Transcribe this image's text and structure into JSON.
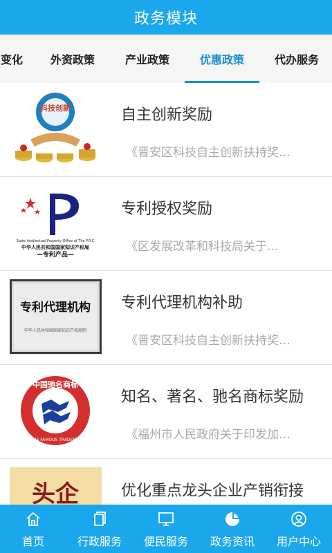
{
  "header": {
    "title": "政务模块"
  },
  "tabs": [
    {
      "label": "变化",
      "active": false
    },
    {
      "label": "外资政策",
      "active": false
    },
    {
      "label": "产业政策",
      "active": false
    },
    {
      "label": "优惠政策",
      "active": true
    },
    {
      "label": "代办服务",
      "active": false
    }
  ],
  "items": [
    {
      "title": "自主创新奖励",
      "summary": "《晋安区科技自主创新扶持奖…",
      "thumb_text": "科技创新"
    },
    {
      "title": "专利授权奖励",
      "summary": "《区发展改革和科技局关于…",
      "thumb_text_1": "State Intellectual Property Office of The P.R.C",
      "thumb_text_2": "中华人民共和国国家知识产权局",
      "thumb_text_3": "—专利产品—"
    },
    {
      "title": "专利代理机构补助",
      "summary": "《晋安区科技自主创新扶持奖…",
      "thumb_text_1": "专利代理机构",
      "thumb_text_2": "中华人民共和国国家知识产权局制"
    },
    {
      "title": "知名、著名、驰名商标奖励",
      "summary": "《福州市人民政府关于印发加…",
      "thumb_text_1": "中国驰名商标",
      "thumb_text_2": "CHINA FAMOUS TRADEMARK"
    },
    {
      "title": "优化重点龙头企业产销衔接",
      "summary": "",
      "thumb_text": "头企"
    }
  ],
  "bottom_nav": [
    {
      "label": "首页",
      "icon": "home-icon"
    },
    {
      "label": "行政服务",
      "icon": "document-icon"
    },
    {
      "label": "便民服务",
      "icon": "monitor-icon"
    },
    {
      "label": "政务资讯",
      "icon": "pie-chart-icon"
    },
    {
      "label": "用户中心",
      "icon": "user-icon"
    }
  ],
  "colors": {
    "primary": "#1aa7ec",
    "active_tab": "#1a8fd0",
    "title_text": "#333333",
    "summary_text": "#a8a8a8"
  }
}
